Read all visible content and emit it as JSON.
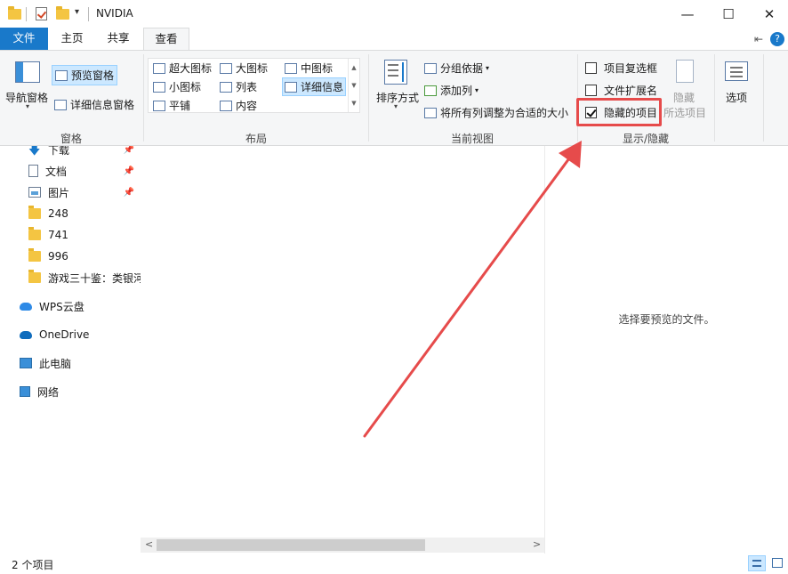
{
  "window": {
    "title": "NVIDIA",
    "minimize": "—",
    "maximize": "☐",
    "close": "✕"
  },
  "tabs": {
    "file": "文件",
    "home": "主页",
    "share": "共享",
    "view": "查看",
    "collapse_glyph": "⇤",
    "help_glyph": "?"
  },
  "ribbon": {
    "panes": {
      "label": "窗格",
      "nav_pane": "导航窗格",
      "preview_pane": "预览窗格",
      "details_pane": "详细信息窗格"
    },
    "layout": {
      "label": "布局",
      "items": [
        "超大图标",
        "大图标",
        "中图标",
        "小图标",
        "列表",
        "详细信息",
        "平铺",
        "内容"
      ],
      "selected": "详细信息"
    },
    "current_view": {
      "label": "当前视图",
      "sort_by": "排序方式",
      "group_by": "分组依据",
      "add_columns": "添加列",
      "fit_columns": "将所有列调整为合适的大小"
    },
    "show_hide": {
      "label": "显示/隐藏",
      "item_checkboxes": "项目复选框",
      "file_extensions": "文件扩展名",
      "hidden_items": "隐藏的项目",
      "item_checkboxes_checked": false,
      "file_extensions_checked": false,
      "hidden_items_checked": true,
      "hide_selected_1": "隐藏",
      "hide_selected_2": "所选项目"
    },
    "options": "选项"
  },
  "nav": {
    "items": [
      {
        "label": "下载",
        "icon": "download-icon",
        "pinned": true
      },
      {
        "label": "文档",
        "icon": "document-icon",
        "pinned": true
      },
      {
        "label": "图片",
        "icon": "pictures-icon",
        "pinned": true
      },
      {
        "label": "248",
        "icon": "folder-icon",
        "pinned": false
      },
      {
        "label": "741",
        "icon": "folder-icon",
        "pinned": false
      },
      {
        "label": "996",
        "icon": "folder-icon",
        "pinned": false
      },
      {
        "label": "游戏三十鉴：类银河",
        "icon": "folder-icon",
        "pinned": false
      },
      {
        "label": "WPS云盘",
        "icon": "cloud-icon",
        "pinned": false
      },
      {
        "label": "OneDrive",
        "icon": "onedrive-icon",
        "pinned": false
      },
      {
        "label": "此电脑",
        "icon": "computer-icon",
        "pinned": false
      },
      {
        "label": "网络",
        "icon": "network-icon",
        "pinned": false
      }
    ]
  },
  "preview": {
    "empty_text": "选择要预览的文件。"
  },
  "status": {
    "item_count": "2 个项目"
  },
  "colors": {
    "accent": "#1979ca",
    "highlight": "#e64b4b",
    "selected_bg": "#cce8ff"
  }
}
